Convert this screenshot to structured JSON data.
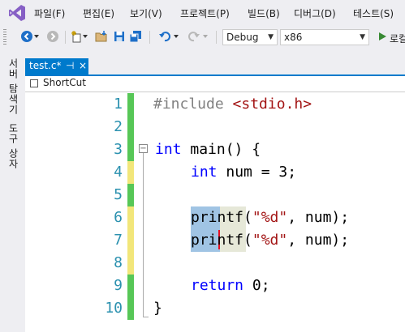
{
  "menu": {
    "items": [
      "파일(F)",
      "편집(E)",
      "보기(V)",
      "프로젝트(P)",
      "빌드(B)",
      "디버그(D)",
      "테스트(S)"
    ]
  },
  "toolbar": {
    "configuration": "Debug",
    "platform": "x86",
    "run_label": "로컬"
  },
  "side_tabs": [
    "서버 탐색기",
    "도구 상자"
  ],
  "document": {
    "tab_title": "test.c*",
    "pin_glyph": "⊣",
    "close_glyph": "×",
    "nav_scope": "ShortCut"
  },
  "editor": {
    "line_numbers": [
      "1",
      "2",
      "3",
      "4",
      "5",
      "6",
      "7",
      "8",
      "9",
      "10"
    ],
    "fold_glyph": "−"
  },
  "colors": {
    "accent": "#007acc",
    "change_saved": "#57c757",
    "change_unsaved": "#f2e67a",
    "line_number": "#2b91af",
    "keyword": "#0000ff",
    "string": "#a31515",
    "preprocessor": "#808080"
  }
}
